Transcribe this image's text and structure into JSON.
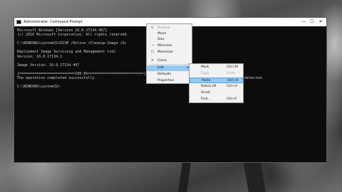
{
  "window": {
    "title": "Administrator: Command Prompt",
    "controls": {
      "minimize": "—",
      "maximize": "☐",
      "close": "✕"
    }
  },
  "console": {
    "lines": [
      "Microsoft Windows [Version 10.0.17134.407]",
      "(c) 2018 Microsoft Corporation. All rights reserved.",
      "",
      "C:\\WINDOWS\\system32>DISM /Online /Cleanup-Image /Sc",
      "",
      "Deployment Image Servicing and Management tool",
      "Version: 10.0.17134.1",
      "",
      "Image Version: 10.0.17134.407",
      "",
      "[==========================100.0%==========================] ",
      "The operation completed successfully.",
      "",
      "C:\\WINDOWS\\system32>"
    ],
    "overflow_text": "detected."
  },
  "system_menu": {
    "items": [
      {
        "label": "Restore",
        "icon": "⧉",
        "disabled": true
      },
      {
        "label": "Move",
        "icon": "",
        "disabled": false
      },
      {
        "label": "Size",
        "icon": "",
        "disabled": false
      },
      {
        "label": "Minimize",
        "icon": "—",
        "disabled": false
      },
      {
        "label": "Maximize",
        "icon": "☐",
        "disabled": false
      },
      {
        "label": "Close",
        "icon": "✕",
        "disabled": false
      },
      {
        "label": "Edit",
        "icon": "",
        "disabled": false,
        "submenu_arrow": "▸",
        "highlighted": true
      },
      {
        "label": "Defaults",
        "icon": "",
        "disabled": false
      },
      {
        "label": "Properties",
        "icon": "",
        "disabled": false
      }
    ]
  },
  "edit_menu": {
    "items": [
      {
        "label": "Mark",
        "shortcut": "Ctrl+M",
        "disabled": false
      },
      {
        "label": "Copy",
        "shortcut": "Enter",
        "disabled": true
      },
      {
        "label": "Paste",
        "shortcut": "Ctrl+V",
        "disabled": false,
        "highlighted": true
      },
      {
        "label": "Select All",
        "shortcut": "Ctrl+A",
        "disabled": false
      },
      {
        "label": "Scroll",
        "shortcut": "",
        "disabled": false
      },
      {
        "label": "Find...",
        "shortcut": "Ctrl+F",
        "disabled": false
      }
    ]
  }
}
